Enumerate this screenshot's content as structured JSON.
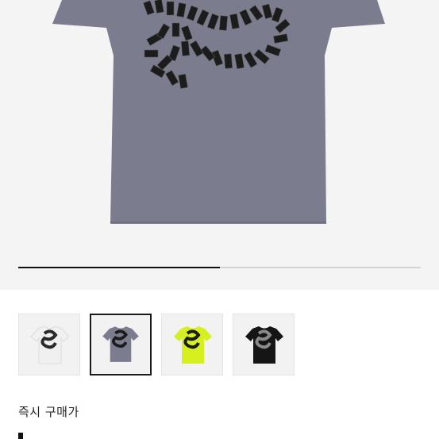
{
  "product": {
    "hero_image": "gray-tshirt-domino-graphic",
    "gallery_progress": 0.5,
    "thumbnails": [
      {
        "name": "white-tshirt-thumbnail",
        "shirt_color": "#f0f0f0",
        "selected": false
      },
      {
        "name": "gray-tshirt-thumbnail",
        "shirt_color": "#7b7d8f",
        "selected": true
      },
      {
        "name": "lime-tshirt-thumbnail",
        "shirt_color": "#d6f01f",
        "selected": false
      },
      {
        "name": "black-tshirt-thumbnail",
        "shirt_color": "#151515",
        "selected": false
      }
    ],
    "instant_buy_label": "즉시 구매가"
  },
  "colors": {
    "hero_background": "#f4f4f4",
    "shirt_gray": "#7b7d8f",
    "progress_active": "#111111",
    "progress_track": "#d4d4d4"
  }
}
